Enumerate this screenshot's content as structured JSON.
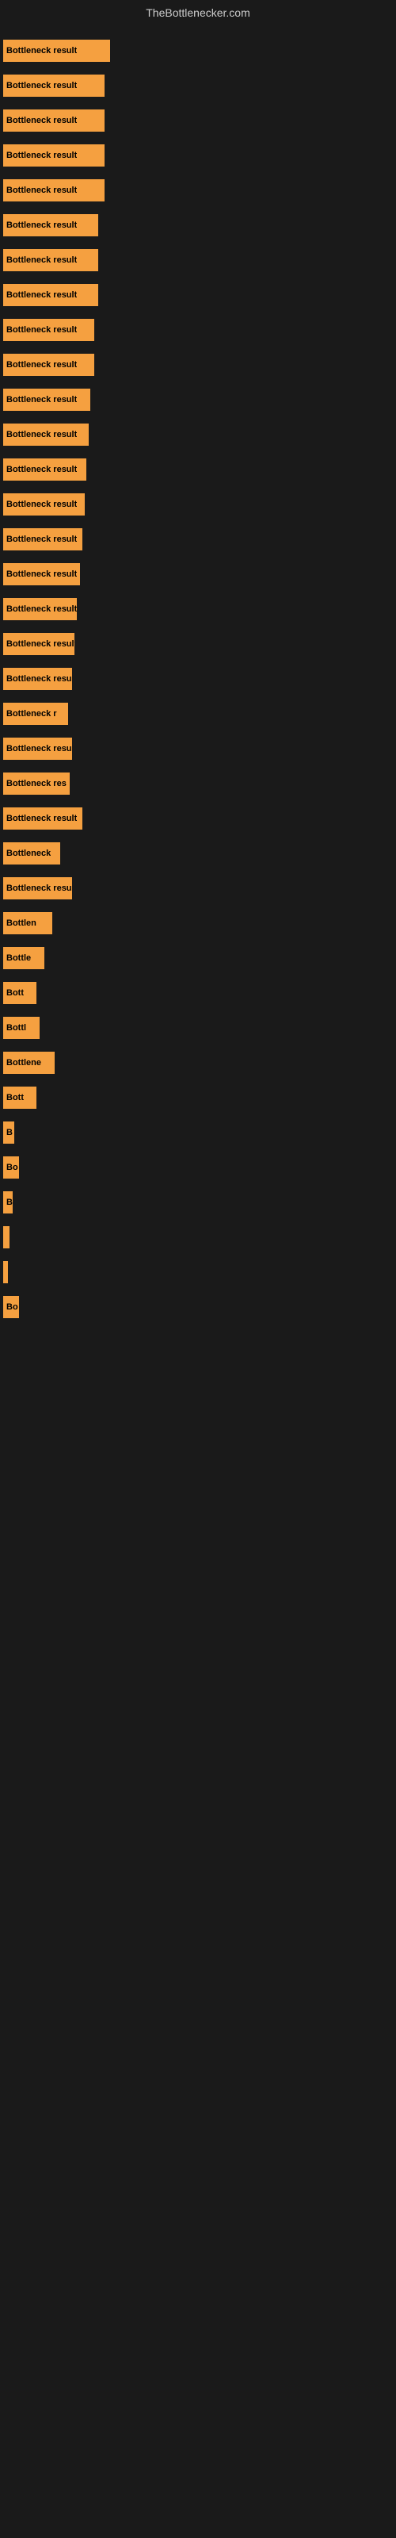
{
  "site": {
    "title": "TheBottlenecker.com"
  },
  "bars": [
    {
      "label": "Bottleneck result",
      "width": 135
    },
    {
      "label": "Bottleneck result",
      "width": 128
    },
    {
      "label": "Bottleneck result",
      "width": 128
    },
    {
      "label": "Bottleneck result",
      "width": 128
    },
    {
      "label": "Bottleneck result",
      "width": 128
    },
    {
      "label": "Bottleneck result",
      "width": 120
    },
    {
      "label": "Bottleneck result",
      "width": 120
    },
    {
      "label": "Bottleneck result",
      "width": 120
    },
    {
      "label": "Bottleneck result",
      "width": 115
    },
    {
      "label": "Bottleneck result",
      "width": 115
    },
    {
      "label": "Bottleneck result",
      "width": 110
    },
    {
      "label": "Bottleneck result",
      "width": 108
    },
    {
      "label": "Bottleneck result",
      "width": 105
    },
    {
      "label": "Bottleneck result",
      "width": 103
    },
    {
      "label": "Bottleneck result",
      "width": 100
    },
    {
      "label": "Bottleneck result",
      "width": 97
    },
    {
      "label": "Bottleneck result",
      "width": 93
    },
    {
      "label": "Bottleneck result",
      "width": 90
    },
    {
      "label": "Bottleneck resu",
      "width": 87
    },
    {
      "label": "Bottleneck r",
      "width": 82
    },
    {
      "label": "Bottleneck resu",
      "width": 87
    },
    {
      "label": "Bottleneck res",
      "width": 84
    },
    {
      "label": "Bottleneck result",
      "width": 100
    },
    {
      "label": "Bottleneck",
      "width": 72
    },
    {
      "label": "Bottleneck resu",
      "width": 87
    },
    {
      "label": "Bottlen",
      "width": 62
    },
    {
      "label": "Bottle",
      "width": 52
    },
    {
      "label": "Bott",
      "width": 42
    },
    {
      "label": "Bottl",
      "width": 46
    },
    {
      "label": "Bottlene",
      "width": 65
    },
    {
      "label": "Bott",
      "width": 42
    },
    {
      "label": "B",
      "width": 14
    },
    {
      "label": "Bo",
      "width": 20
    },
    {
      "label": "B",
      "width": 12
    },
    {
      "label": "",
      "width": 8
    },
    {
      "label": "",
      "width": 6
    },
    {
      "label": "Bo",
      "width": 20
    }
  ]
}
